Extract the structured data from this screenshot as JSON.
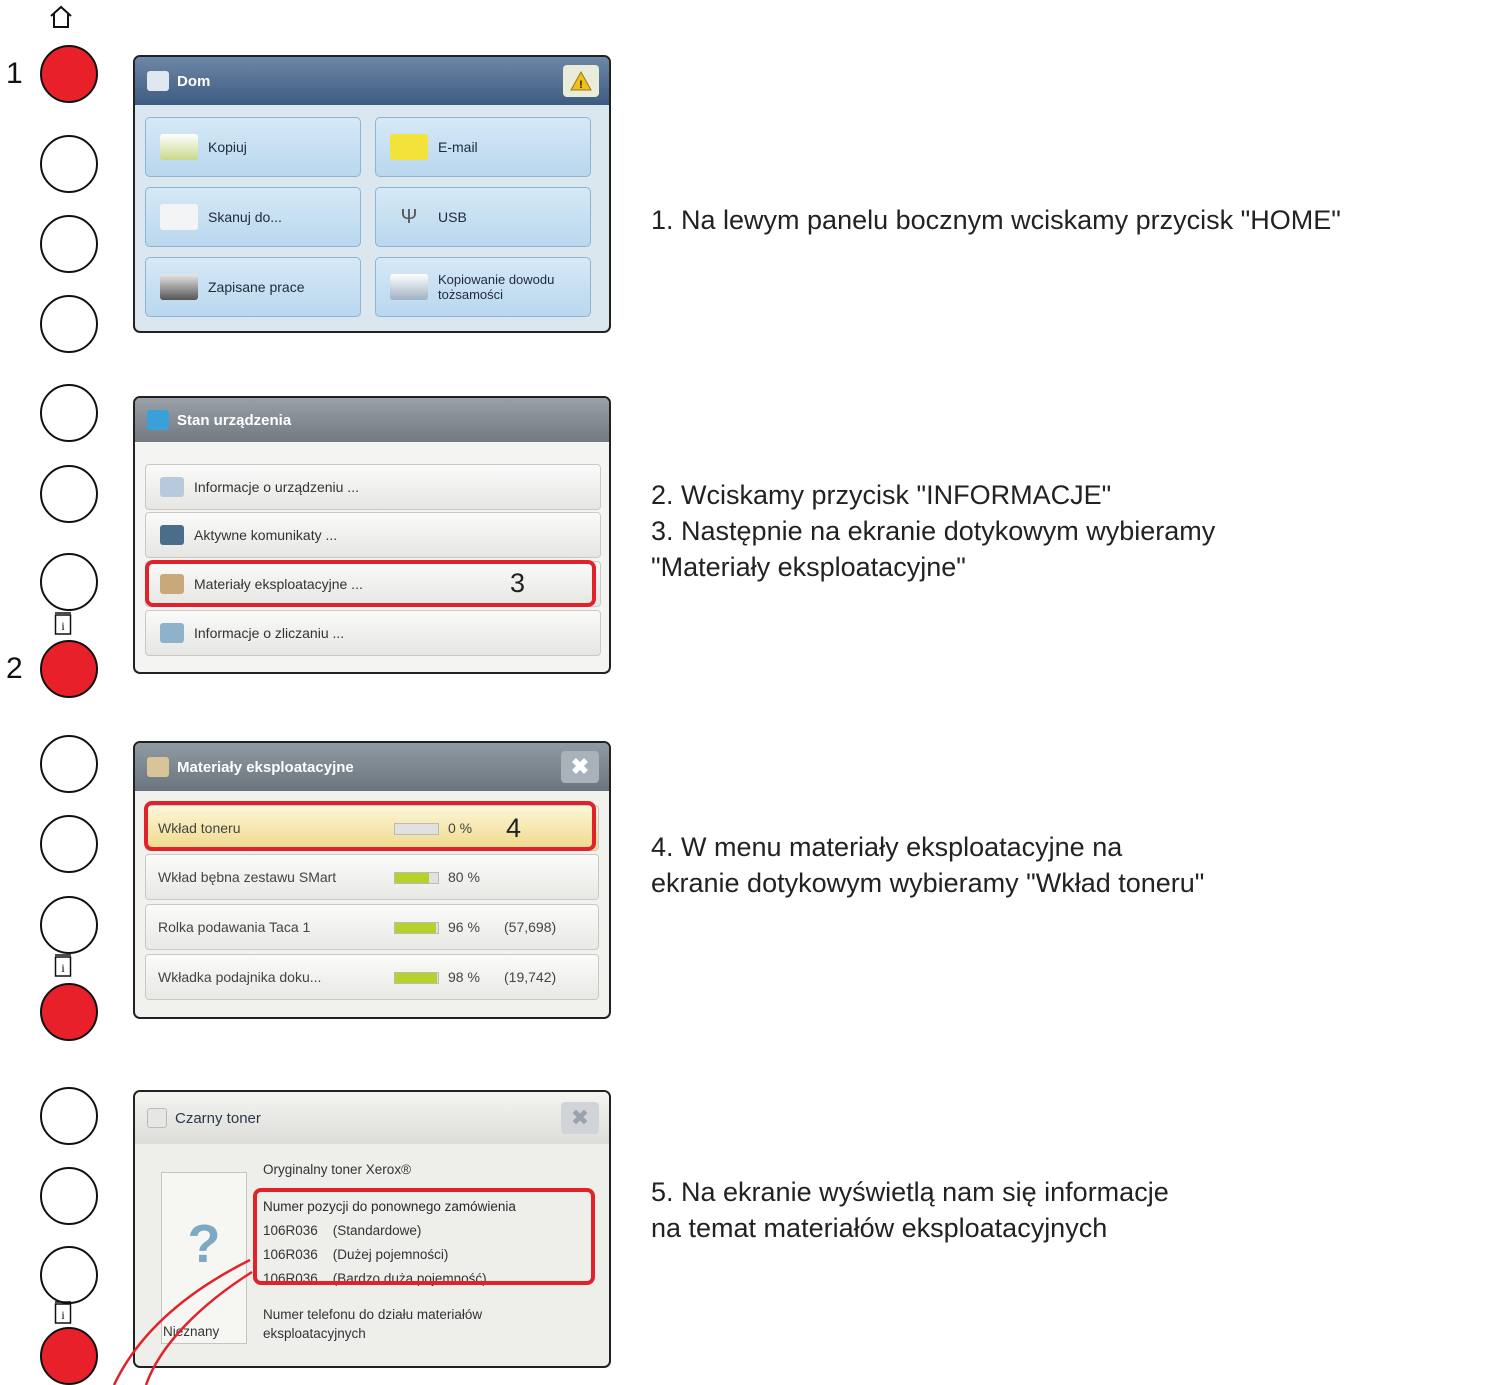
{
  "side_panel": {
    "home_icon": "home-icon",
    "info_icon": "info-icon",
    "numbers": [
      "1",
      "2"
    ]
  },
  "panel1": {
    "title": "Dom",
    "tiles": [
      "Kopiuj",
      "E-mail",
      "Skanuj do...",
      "USB",
      "Zapisane prace",
      "Kopiowanie dowodu tożsamości"
    ]
  },
  "panel2": {
    "title": "Stan urządzenia",
    "items": [
      "Informacje o urządzeniu ...",
      "Aktywne komunikaty ...",
      "Materiały eksploatacyjne ...",
      "Informacje o zliczaniu ..."
    ],
    "highlight_num": "3"
  },
  "panel3": {
    "title": "Materiały eksploatacyjne",
    "rows": [
      {
        "label": "Wkład toneru",
        "percent": "0 %",
        "count": "",
        "level": 0
      },
      {
        "label": "Wkład bębna zestawu SMart",
        "percent": "80 %",
        "count": "",
        "level": 0.8
      },
      {
        "label": "Rolka podawania Taca 1",
        "percent": "96 %",
        "count": "(57,698)",
        "level": 0.96
      },
      {
        "label": "Wkładka podajnika doku...",
        "percent": "98 %",
        "count": "(19,742)",
        "level": 0.98
      }
    ],
    "highlight_num": "4"
  },
  "panel4": {
    "title": "Czarny toner",
    "unknown_label": "Nieznany",
    "heading": "Oryginalny toner Xerox®",
    "reorder_heading": "Numer pozycji do ponownego zamówienia",
    "parts": [
      "106R036    (Standardowe)",
      "106R036    (Dużej pojemności)",
      "106R036    (Bardzo duża pojemność)"
    ],
    "phone_heading": "Numer telefonu do działu materiałów",
    "phone_heading2": "eksploatacyjnych"
  },
  "instructions": {
    "step1": "1. Na lewym panelu bocznym wciskamy przycisk \"HOME\"",
    "step2": "2. Wciskamy przycisk \"INFORMACJE\"",
    "step3a": "3. Następnie na ekranie dotykowym wybieramy",
    "step3b": "\"Materiały eksploatacyjne\"",
    "step4a": "4. W menu materiały eksploatacyjne na",
    "step4b": "ekranie dotykowym wybieramy \"Wkład toneru\"",
    "step5a": "5. Na ekranie wyświetlą nam się informacje",
    "step5b": "na temat materiałów eksploatacyjnych"
  },
  "colors": {
    "accent_red": "#e2222b",
    "button_red": "#e8202a"
  }
}
